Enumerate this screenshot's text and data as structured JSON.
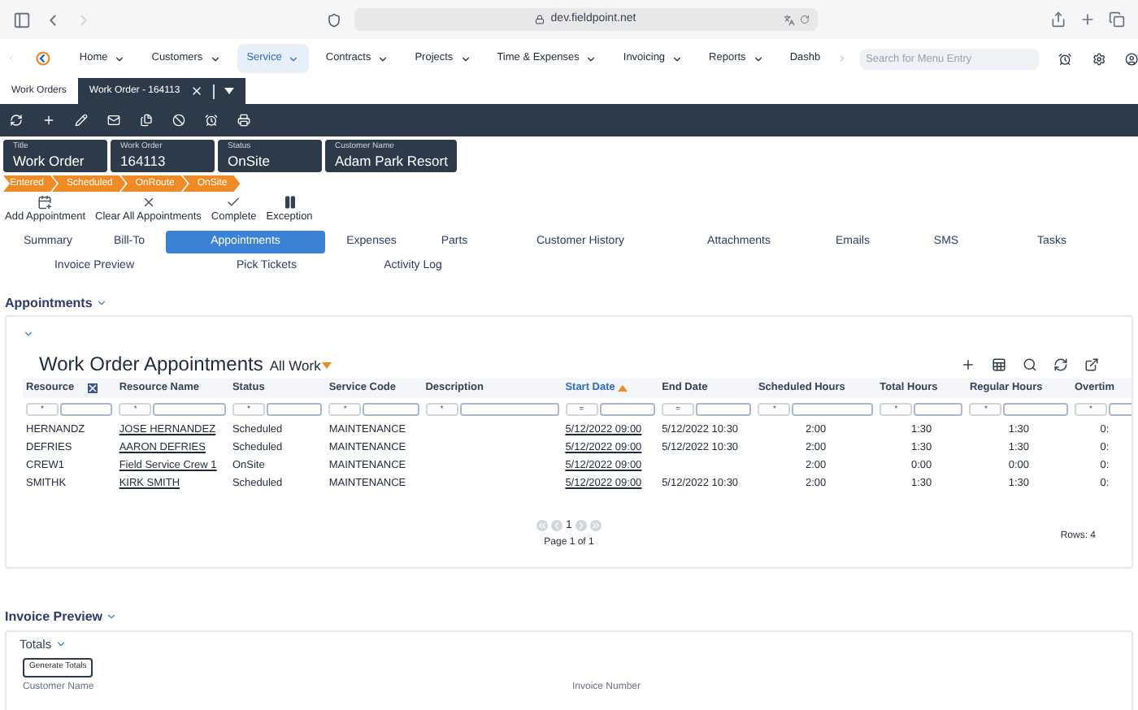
{
  "browser": {
    "url": "dev.fieldpoint.net"
  },
  "menu": {
    "items": [
      {
        "label": "Home",
        "selected": false
      },
      {
        "label": "Customers",
        "selected": false
      },
      {
        "label": "Service",
        "selected": true
      },
      {
        "label": "Contracts",
        "selected": false
      },
      {
        "label": "Projects",
        "selected": false
      },
      {
        "label": "Time & Expenses",
        "selected": false
      },
      {
        "label": "Invoicing",
        "selected": false
      },
      {
        "label": "Reports",
        "selected": false
      },
      {
        "label": "Dashb",
        "selected": false
      }
    ],
    "search": {
      "placeholder": "Search for Menu Entry"
    }
  },
  "doc_tabs": [
    {
      "label": "Work Orders",
      "selected": false
    },
    {
      "label": "Work Order - 164113",
      "selected": true
    }
  ],
  "header_fields": [
    {
      "label": "Title",
      "value": "Work Order"
    },
    {
      "label": "Work Order",
      "value": "164113"
    },
    {
      "label": "Status",
      "value": "OnSite"
    },
    {
      "label": "Customer Name",
      "value": "Adam Park Resort"
    }
  ],
  "status_steps": [
    "Entered",
    "Scheduled",
    "OnRoute",
    "OnSite"
  ],
  "actions": [
    {
      "kind": "calendar",
      "label": "Add Appointment"
    },
    {
      "kind": "clear",
      "label": "Clear All Appointments"
    },
    {
      "kind": "check",
      "label": "Complete"
    },
    {
      "kind": "pause",
      "label": "Exception"
    }
  ],
  "nav_tabs": [
    [
      {
        "label": "Summary",
        "selected": false
      },
      {
        "label": "Bill-To",
        "selected": false
      },
      {
        "label": "Appointments",
        "selected": true
      },
      {
        "label": "Expenses",
        "selected": false
      },
      {
        "label": "Parts",
        "selected": false
      },
      {
        "label": "Customer History",
        "selected": false
      },
      {
        "label": "Attachments",
        "selected": false
      },
      {
        "label": "Emails",
        "selected": false
      },
      {
        "label": "SMS",
        "selected": false
      },
      {
        "label": "Tasks",
        "selected": false
      }
    ],
    [
      {
        "label": "Invoice Preview",
        "selected": false
      },
      {
        "label": "Pick Tickets",
        "selected": false
      },
      {
        "label": "Activity Log",
        "selected": false
      }
    ]
  ],
  "appointments": {
    "section_title": "Appointments",
    "title": "Work Order Appointments",
    "view": "All Work",
    "columns": [
      {
        "label": "Resource",
        "filter_op": "*",
        "link": false,
        "sorted": false
      },
      {
        "label": "Resource Name",
        "filter_op": "*",
        "link": true,
        "sorted": false
      },
      {
        "label": "Status",
        "filter_op": "*",
        "link": false,
        "sorted": false
      },
      {
        "label": "Service Code",
        "filter_op": "*",
        "link": false,
        "sorted": false
      },
      {
        "label": "Description",
        "filter_op": "*",
        "sorted": false
      },
      {
        "label": "Start Date",
        "filter_op": "=",
        "link": true,
        "sorted": true
      },
      {
        "label": "End Date",
        "filter_op": "=",
        "link": false,
        "sorted": false
      },
      {
        "label": "Scheduled Hours",
        "filter_op": "*",
        "link": false,
        "sorted": false
      },
      {
        "label": "Total Hours",
        "filter_op": "*",
        "link": false,
        "sorted": false
      },
      {
        "label": "Regular Hours",
        "filter_op": "*",
        "link": false,
        "sorted": false
      },
      {
        "label": "Overtim",
        "filter_op": "*",
        "link": false,
        "sorted": false
      }
    ],
    "rows": [
      [
        "HERNANDZ",
        "JOSE HERNANDEZ",
        "Scheduled",
        "MAINTENANCE",
        "",
        "5/12/2022 09:00",
        "5/12/2022 10:30",
        "2:00",
        "1:30",
        "1:30",
        "0:"
      ],
      [
        "DEFRIES",
        "AARON DEFRIES",
        "Scheduled",
        "MAINTENANCE",
        "",
        "5/12/2022 09:00",
        "5/12/2022 10:30",
        "2:00",
        "1:30",
        "1:30",
        "0:"
      ],
      [
        "CREW1",
        "Field Service Crew 1",
        "OnSite",
        "MAINTENANCE",
        "",
        "5/12/2022 09:00",
        "",
        "2:00",
        "0:00",
        "0:00",
        "0:"
      ],
      [
        "SMITHK",
        "KIRK SMITH",
        "Scheduled",
        "MAINTENANCE",
        "",
        "5/12/2022 09:00",
        "5/12/2022 10:30",
        "2:00",
        "1:30",
        "1:30",
        "0:"
      ]
    ],
    "page": "1",
    "page_info": "Page 1 of 1",
    "rows_count": "Rows: 4"
  },
  "invoice": {
    "section_title": "Invoice Preview",
    "subsection": "Totals",
    "button": "Generate Totals",
    "fields": [
      "Customer Name",
      "Invoice Number"
    ]
  }
}
